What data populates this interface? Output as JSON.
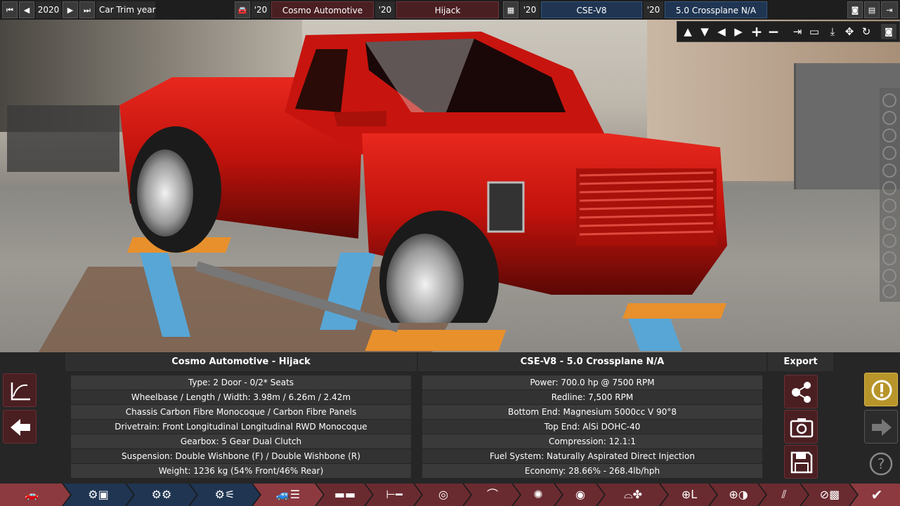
{
  "topbar": {
    "year": "2020",
    "trim_label": "Car Trim year",
    "car_year": "'20",
    "company": "Cosmo Automotive",
    "model_year": "'20",
    "model": "Hijack",
    "engine_year": "'20",
    "engine_family": "CSE-V8",
    "variant_year": "'20",
    "variant": "5.0 Crossplane N/A"
  },
  "car_panel": {
    "title": "Cosmo Automotive - Hijack",
    "rows": [
      "Type: 2 Door - 0/2* Seats",
      "Wheelbase / Length / Width: 3.98m / 6.26m / 2.42m",
      "Chassis Carbon Fibre Monocoque / Carbon Fibre Panels",
      "Drivetrain: Front Longitudinal Longitudinal RWD Monocoque",
      "Gearbox: 5 Gear Dual Clutch",
      "Suspension: Double Wishbone (F) / Double Wishbone (R)",
      "Weight: 1236 kg (54% Front/46% Rear)"
    ]
  },
  "engine_panel": {
    "title": "CSE-V8 - 5.0 Crossplane N/A",
    "rows": [
      "Power: 700.0 hp @ 7500 RPM",
      "Redline:  7,500 RPM",
      "Bottom End: Magnesium 5000cc V 90°8",
      "Top End: AlSi DOHC-40",
      "Compression: 12.1:1",
      "Fuel System: Naturally Aspirated Direct Injection",
      "Economy: 28.66% - 268.4lb/hph"
    ]
  },
  "export": {
    "title": "Export"
  },
  "colors": {
    "accent": "#4a1f22",
    "navy": "#1f3552",
    "warning": "#b8952a",
    "active_tab": "#8c3a40"
  }
}
